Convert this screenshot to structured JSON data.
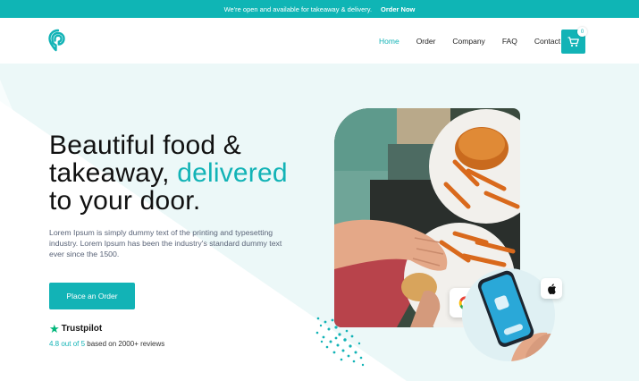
{
  "announcement": {
    "text": "We're open and available for takeaway & delivery.",
    "link": "Order Now"
  },
  "nav": {
    "items": [
      {
        "label": "Home",
        "active": true
      },
      {
        "label": "Order",
        "active": false
      },
      {
        "label": "Company",
        "active": false
      },
      {
        "label": "FAQ",
        "active": false
      },
      {
        "label": "Contact",
        "active": false
      }
    ],
    "cart_count": "0"
  },
  "hero": {
    "title_line1": "Beautiful food &",
    "title_line2_a": "takeaway,",
    "title_line2_accent": "delivered",
    "title_line3": "to your door.",
    "description": "Lorem Ipsum is simply dummy text of the printing and typesetting industry. Lorem Ipsum has been the industry's standard dummy text ever since the 1500.",
    "cta_label": "Place an Order",
    "trustpilot_label": "Trustpilot",
    "rating_highlight": "4.8 out of 5",
    "rating_rest": "based on 2000+ reviews"
  },
  "colors": {
    "accent": "#12b3b6",
    "topbar": "#0fb5b5",
    "hero_tint": "#ecf8f8",
    "trustpilot_green": "#00b67a"
  },
  "icons": [
    "location-pin-logo-icon",
    "cart-icon",
    "star-icon",
    "google-icon",
    "apple-icon"
  ]
}
